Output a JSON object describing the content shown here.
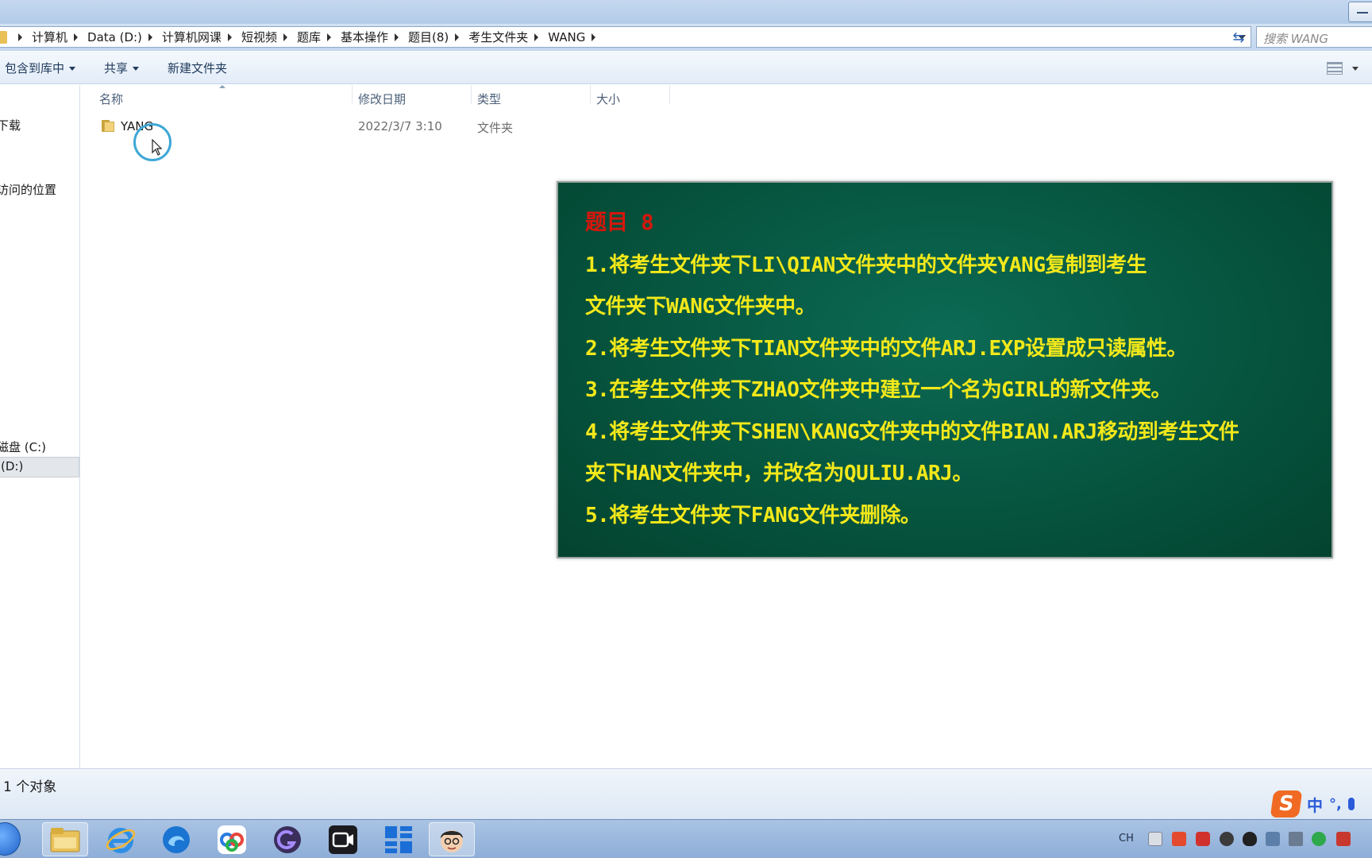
{
  "address": {
    "crumbs": [
      "计算机",
      "Data (D:)",
      "计算机网课",
      "短视频",
      "题库",
      "基本操作",
      "题目(8)",
      "考生文件夹",
      "WANG"
    ],
    "search_placeholder": "搜索 WANG"
  },
  "toolbar": {
    "include_library": "包含到库中",
    "share": "共享",
    "new_folder": "新建文件夹"
  },
  "nav": {
    "items": [
      "下载",
      "访问的位置",
      "磁盘 (C:)",
      "(D:)"
    ]
  },
  "columns": {
    "name": "名称",
    "modified": "修改日期",
    "type": "类型",
    "size": "大小"
  },
  "files": [
    {
      "name": "YANG",
      "modified": "2022/3/7 3:10",
      "type": "文件夹",
      "size": ""
    }
  ],
  "board": {
    "title": "题目 8",
    "lines": [
      "1.将考生文件夹下LI\\QIAN文件夹中的文件夹YANG复制到考生",
      "文件夹下WANG文件夹中。",
      "2.将考生文件夹下TIAN文件夹中的文件ARJ.EXP设置成只读属性。",
      "3.在考生文件夹下ZHAO文件夹中建立一个名为GIRL的新文件夹。",
      "4.将考生文件夹下SHEN\\KANG文件夹中的文件BIAN.ARJ移动到考生文件",
      "夹下HAN文件夹中，并改名为QULIU.ARJ。",
      "5.将考生文件夹下FANG文件夹删除。"
    ]
  },
  "status": {
    "count": "1 个对象"
  },
  "ime": {
    "logo": "S",
    "mode": "中",
    "punct": "°,"
  },
  "tray": {
    "lang": "CH"
  },
  "colors": {
    "board_bg": "#06553f",
    "board_title": "#d8160c",
    "board_text": "#f3e81a",
    "cursor_ring": "#3ea7d6"
  },
  "icons": {
    "taskbar": [
      "start-orb-icon",
      "explorer-folder-icon",
      "internet-explorer-icon",
      "edge-browser-icon",
      "baidu-netdisk-icon",
      "screen-recorder-icon",
      "video-camera-icon",
      "grid-app-icon",
      "avatar-app-icon"
    ]
  }
}
